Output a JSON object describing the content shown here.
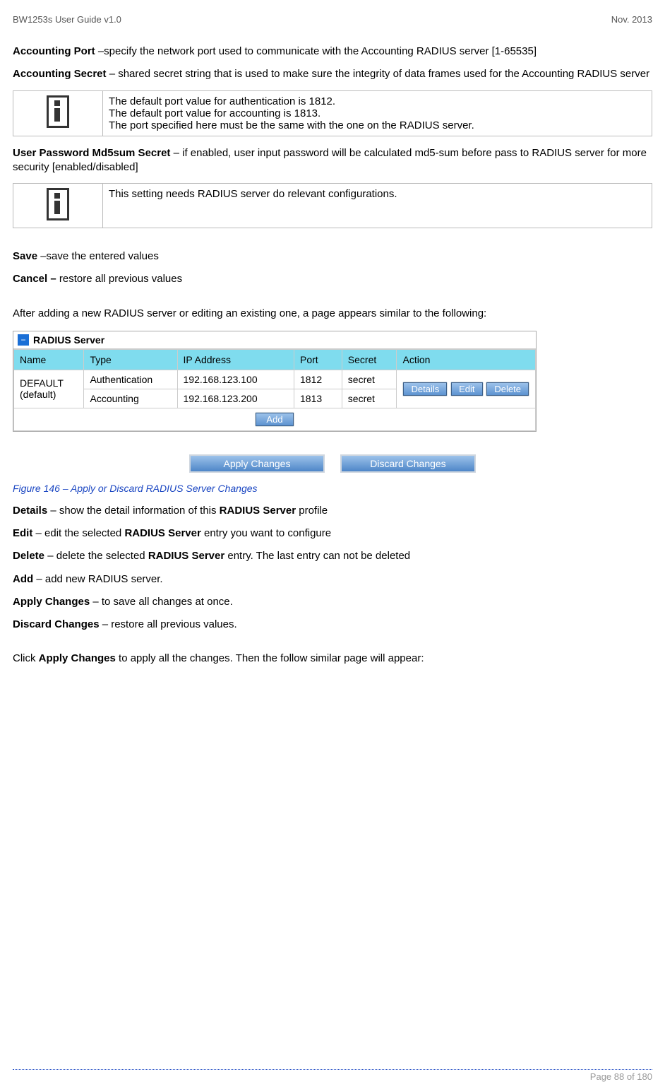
{
  "header": {
    "left": "BW1253s User Guide v1.0",
    "right": "Nov.  2013"
  },
  "p1_label": "Accounting Port",
  "p1_rest": " –specify the network port used to communicate with the Accounting RADIUS server [1-65535]",
  "p2_label": "Accounting Secret",
  "p2_rest": " – shared secret string that is used to make sure the integrity of data frames used for the Accounting RADIUS server",
  "info1": {
    "l1": "The default port value for authentication is 1812.",
    "l2": "The default port value for accounting is 1813.",
    "l3": "The port specified here must be the same with the one on the RADIUS server."
  },
  "p3_label": "User Password Md5sum Secret",
  "p3_rest": " – if enabled, user input password will be calculated md5-sum before pass to RADIUS server for more security [enabled/disabled]",
  "info2": {
    "l1": "This setting needs RADIUS server do relevant configurations."
  },
  "p4_label": "Save",
  "p4_rest": " –save the entered values",
  "p5_label": "Cancel –",
  "p5_rest": " restore all previous values",
  "p6": "After adding a new RADIUS server or editing an existing one, a page appears similar to the following:",
  "radius": {
    "title": "RADIUS Server",
    "headers": {
      "name": "Name",
      "type": "Type",
      "ip": "IP Address",
      "port": "Port",
      "secret": "Secret",
      "action": "Action"
    },
    "nameCell": "DEFAULT (default)",
    "rows": [
      {
        "type": "Authentication",
        "ip": "192.168.123.100",
        "port": "1812",
        "secret": "secret"
      },
      {
        "type": "Accounting",
        "ip": "192.168.123.200",
        "port": "1813",
        "secret": "secret"
      }
    ],
    "buttons": {
      "details": "Details",
      "edit": "Edit",
      "delete": "Delete",
      "add": "Add"
    }
  },
  "mainButtons": {
    "apply": "Apply Changes",
    "discard": "Discard Changes"
  },
  "figCaption": "Figure 146 – Apply or Discard RADIUS Server Changes",
  "defs": {
    "details_l": "Details",
    "details_r": " – show the detail information of this ",
    "details_b": "RADIUS Server",
    "details_e": " profile",
    "edit_l": "Edit",
    "edit_r": " – edit the selected ",
    "edit_b": "RADIUS Server",
    "edit_e": " entry you want to configure",
    "delete_l": "Delete",
    "delete_r": " – delete the selected ",
    "delete_b": "RADIUS Server",
    "delete_e": " entry. The last entry can not be deleted",
    "add_l": "Add",
    "add_r": " – add new RADIUS server.",
    "apply_l": "Apply Changes",
    "apply_r": " – to save all changes at once.",
    "discard_l": "Discard Changes",
    "discard_r": " – restore all previous values."
  },
  "pClick_a": "Click ",
  "pClick_b": "Apply Changes",
  "pClick_c": " to apply all the changes. Then the follow similar page will appear:",
  "footer": {
    "page": "Page 88 of 180"
  }
}
